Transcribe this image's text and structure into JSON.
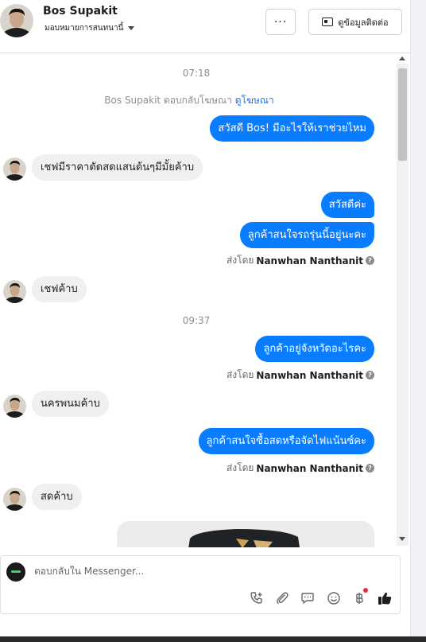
{
  "header": {
    "name": "Bos Supakit",
    "assign_label": "มอบหมายการสนทนานี้",
    "more_label": "···",
    "contact_button": "ดูข้อมูลติดต่อ"
  },
  "thread": {
    "timestamp_1": "07:18",
    "ad_note": "Bos Supakit ตอบกลับโฆษณา",
    "ad_link": "ดูโฆษณา",
    "msg_out_1": "สวัสดี Bos! มีอะไรให้เราช่วยไหม",
    "msg_in_1": "เชฟมีราคาตัดสดแสนต้นๆมีมั้ยค้าบ",
    "msg_out_2": "สวัสดีค่ะ",
    "msg_out_3": "ลูกค้าสนใจรถรุ่นนี้อยู่นะคะ",
    "sent_by_prefix": "ส่งโดย",
    "sent_by_name": "Nanwhan Nanthanit",
    "msg_in_2": "เชฟค้าบ",
    "timestamp_2": "09:37",
    "msg_out_4": "ลูกค้าอยู่จังหวัดอะไรคะ",
    "msg_in_3": "นครพนมค้าบ",
    "msg_out_5": "ลูกค้าสนใจซื้อสดหรือจัดไฟแน้นซ์คะ",
    "msg_in_4": "สดค้าบ"
  },
  "composer": {
    "placeholder": "ตอบกลับใน Messenger..."
  },
  "icons": {
    "call": "phone-plus-icon",
    "attach": "paperclip-icon",
    "reply": "chat-bubble-icon",
    "emoji": "smiley-icon",
    "payment": "baht-icon",
    "like": "thumbs-up-icon"
  },
  "colors": {
    "outgoing_bubble": "#0a7cff",
    "incoming_bubble": "#f0f0f0",
    "link": "#1877f2",
    "like": "#1c1e21",
    "notification_dot": "#f02849"
  }
}
